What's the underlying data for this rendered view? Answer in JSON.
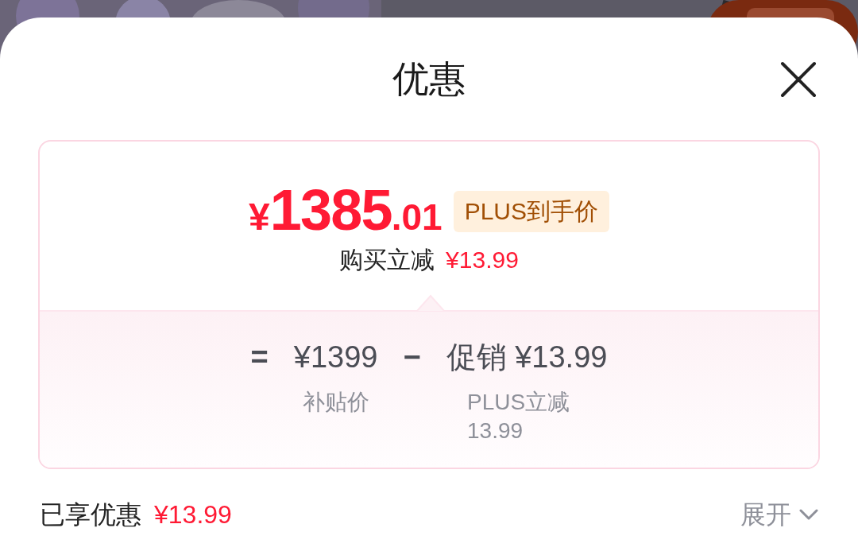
{
  "sheet": {
    "title": "优惠"
  },
  "card": {
    "price": {
      "currency": "¥",
      "integer": "1385",
      "decimal": ".01"
    },
    "badge": "PLUS到手价",
    "discount": {
      "label": "购买立减",
      "amount": "¥13.99"
    },
    "breakdown": [
      {
        "kind": "operator",
        "text": "="
      },
      {
        "kind": "term",
        "text": "¥1399",
        "caption": "补贴价"
      },
      {
        "kind": "operator",
        "text": "−"
      },
      {
        "kind": "term",
        "text": "促销 ¥13.99",
        "caption": "PLUS立减13.99"
      }
    ]
  },
  "summary": {
    "label": "已享优惠",
    "amount": "¥13.99"
  },
  "expand": {
    "label": "展开",
    "expanded": false
  }
}
